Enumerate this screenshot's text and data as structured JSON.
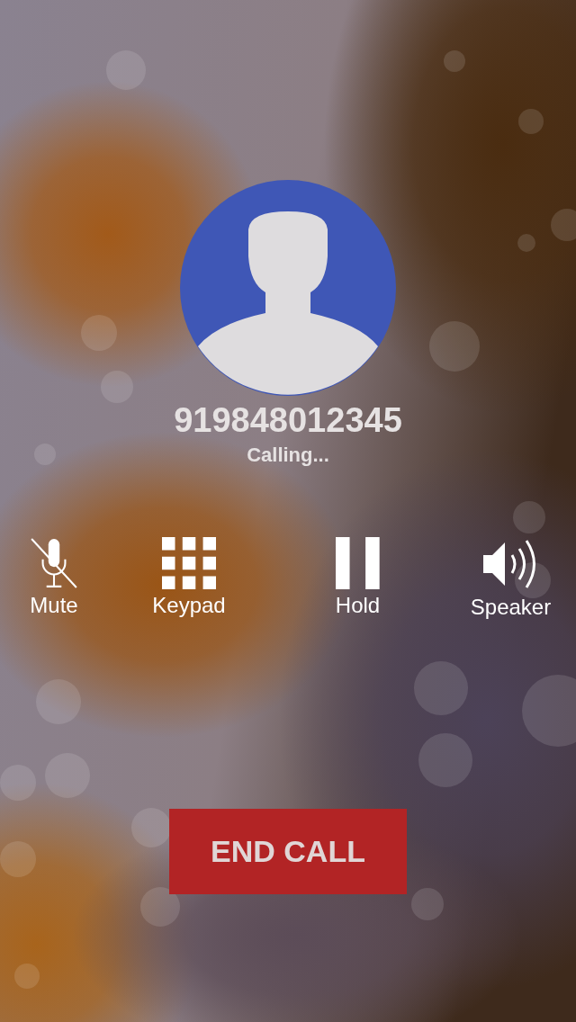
{
  "contact": {
    "number": "919848012345",
    "status": "Calling..."
  },
  "controls": [
    {
      "kind": "mute",
      "label": "Mute"
    },
    {
      "kind": "keypad",
      "label": "Keypad"
    },
    {
      "kind": "hold",
      "label": "Hold"
    },
    {
      "kind": "speaker",
      "label": "Speaker"
    }
  ],
  "end_call": {
    "label": "END CALL"
  }
}
